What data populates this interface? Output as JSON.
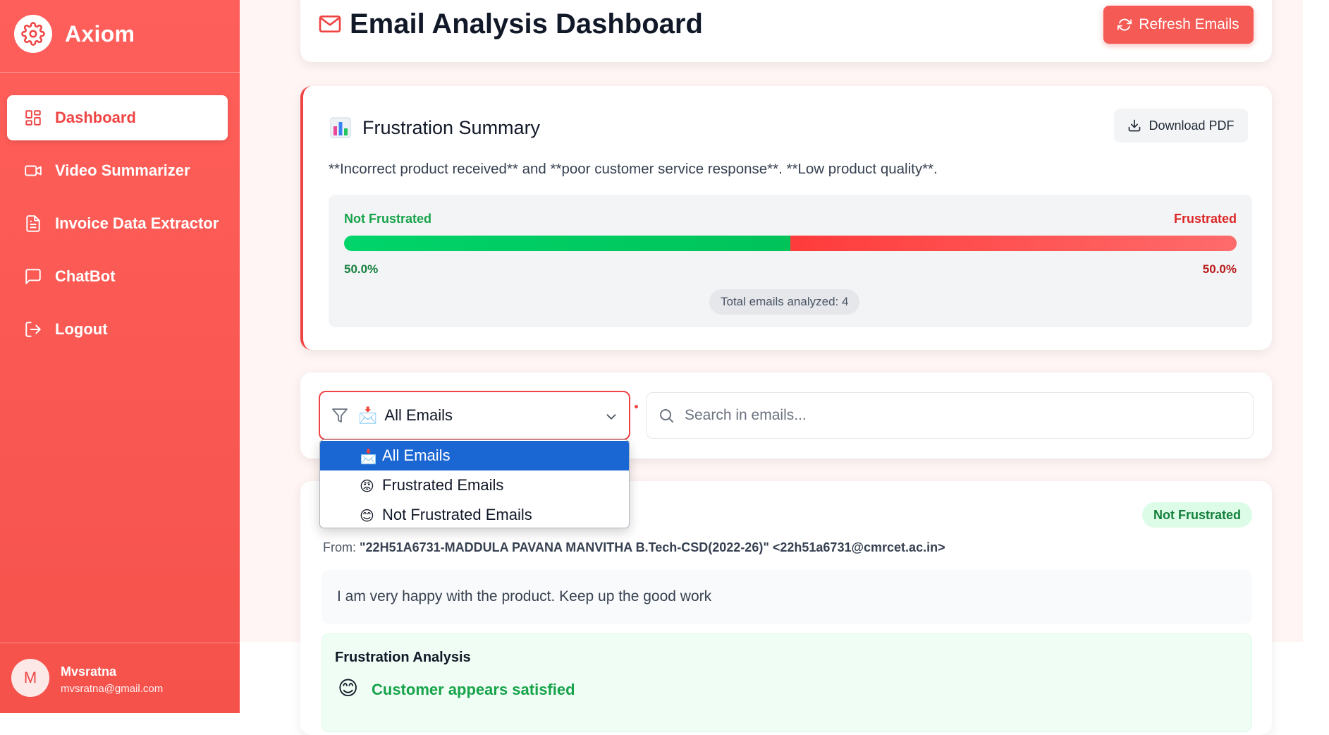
{
  "app": {
    "name": "Axiom"
  },
  "sidebar": {
    "items": [
      {
        "label": "Dashboard",
        "icon": "grid-icon",
        "active": true
      },
      {
        "label": "Video Summarizer",
        "icon": "video-camera-icon",
        "active": false
      },
      {
        "label": "Invoice Data Extractor",
        "icon": "document-icon",
        "active": false
      },
      {
        "label": "ChatBot",
        "icon": "chat-bubble-icon",
        "active": false
      },
      {
        "label": "Logout",
        "icon": "logout-icon",
        "active": false
      }
    ],
    "user": {
      "initial": "M",
      "name": "Mvsratna",
      "email": "mvsratna@gmail.com"
    }
  },
  "header": {
    "title": "Email Analysis Dashboard",
    "refresh_label": "Refresh Emails"
  },
  "summary": {
    "title": "Frustration Summary",
    "download_label": "Download PDF",
    "text": "**Incorrect product received** and **poor customer service response**. **Low product quality**.",
    "not_frustrated_label": "Not Frustrated",
    "frustrated_label": "Frustrated",
    "not_frustrated_pct": "50.0%",
    "frustrated_pct": "50.0%",
    "not_frustrated_fraction": 0.5,
    "total_label": "Total emails analyzed: 4"
  },
  "filter": {
    "selected": "All Emails",
    "selected_emoji": "📩",
    "options": [
      {
        "emoji": "📩",
        "label": "All Emails",
        "selected": true
      },
      {
        "emoji": "😡",
        "label": "Frustrated Emails",
        "selected": false
      },
      {
        "emoji": "😊",
        "label": "Not Frustrated Emails",
        "selected": false
      }
    ],
    "search_placeholder": "Search in emails..."
  },
  "email": {
    "badge": "Not Frustrated",
    "from_label": "From:",
    "from_value": "\"22H51A6731-MADDULA PAVANA MANVITHA B.Tech-CSD(2022-26)\" <22h51a6731@cmrcet.ac.in>",
    "body": "I am very happy with the product. Keep up the good work",
    "analysis_title": "Frustration Analysis",
    "analysis_emoji": "😊",
    "analysis_text": "Customer appears satisfied"
  },
  "colors": {
    "accent": "#ef4444",
    "sidebar": "#f5524c",
    "positive": "#16a34a",
    "negative": "#dc2626",
    "selection": "#1a66d2"
  }
}
